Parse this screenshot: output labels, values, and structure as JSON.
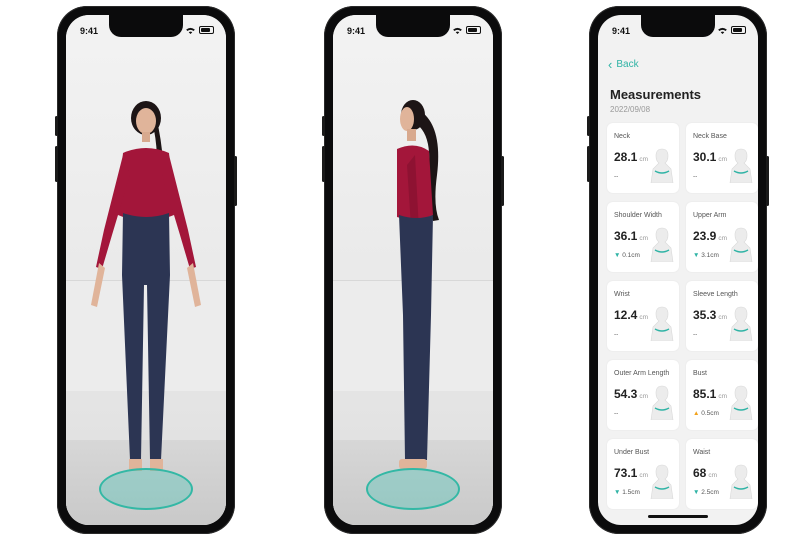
{
  "phones": [
    {
      "status_time": "9:41",
      "view": "front"
    },
    {
      "status_time": "9:41",
      "view": "side"
    },
    {
      "status_time": "9:41",
      "view": "measurements"
    }
  ],
  "measurements": {
    "back_label": "Back",
    "title": "Measurements",
    "date": "2022/09/08",
    "cards": [
      {
        "label": "Neck",
        "value": "28.1",
        "unit": "cm",
        "delta": "--",
        "trend": "none",
        "icon": "neck-figure-icon"
      },
      {
        "label": "Neck Base",
        "value": "30.1",
        "unit": "cm",
        "delta": "--",
        "trend": "none",
        "icon": "neck-base-figure-icon"
      },
      {
        "label": "Shoulder Width",
        "value": "36.1",
        "unit": "cm",
        "delta": "0.1cm",
        "trend": "down",
        "icon": "shoulder-figure-icon"
      },
      {
        "label": "Upper Arm",
        "value": "23.9",
        "unit": "cm",
        "delta": "3.1cm",
        "trend": "down",
        "icon": "upper-arm-figure-icon"
      },
      {
        "label": "Wrist",
        "value": "12.4",
        "unit": "cm",
        "delta": "--",
        "trend": "none",
        "icon": "wrist-figure-icon"
      },
      {
        "label": "Sleeve Length",
        "value": "35.3",
        "unit": "cm",
        "delta": "--",
        "trend": "none",
        "icon": "sleeve-figure-icon"
      },
      {
        "label": "Outer Arm Length",
        "value": "54.3",
        "unit": "cm",
        "delta": "--",
        "trend": "none",
        "icon": "outer-arm-figure-icon"
      },
      {
        "label": "Bust",
        "value": "85.1",
        "unit": "cm",
        "delta": "0.5cm",
        "trend": "up",
        "icon": "bust-figure-icon"
      },
      {
        "label": "Under Bust",
        "value": "73.1",
        "unit": "cm",
        "delta": "1.5cm",
        "trend": "down",
        "icon": "under-bust-figure-icon"
      },
      {
        "label": "Waist",
        "value": "68",
        "unit": "cm",
        "delta": "2.5cm",
        "trend": "down",
        "icon": "waist-figure-icon"
      }
    ]
  },
  "colors": {
    "accent": "#2fb3a5",
    "up": "#f2a21b",
    "down": "#2fb3a5",
    "shirt": "#a3163a",
    "jeans": "#2c3553"
  }
}
